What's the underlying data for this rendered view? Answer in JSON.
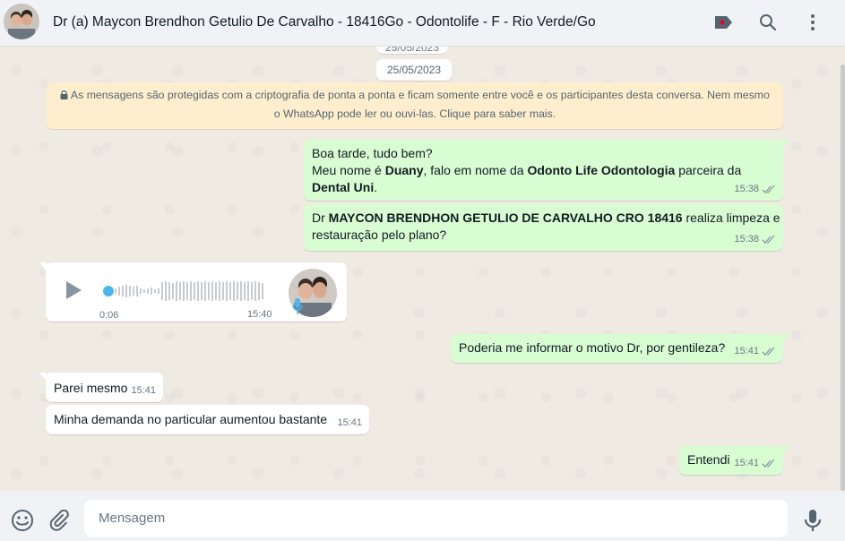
{
  "header": {
    "title": "Dr (a) Maycon Brendhon Getulio De Carvalho - 18416Go - Odontolife - F - Rio Verde/Go"
  },
  "chat": {
    "date_partial": "25/05/2023",
    "date": "25/05/2023",
    "encryption_line1": "As mensagens são protegidas com a criptografia de ponta a ponta e ficam somente entre você e os participantes desta conversa. Nem mesmo",
    "encryption_line2": "o WhatsApp pode ler ou ouvi-las. Clique para saber mais.",
    "messages": [
      {
        "line1": "Boa tarde, tudo bem?",
        "line2_pre": "Meu nome é ",
        "line2_b1": "Duany",
        "line2_mid": ", falo em nome da ",
        "line2_b2": "Odonto Life Odontologia",
        "line2_post": " parceira da",
        "line3_b": "Dental Uni",
        "line3_post": ".",
        "time": "15:38"
      },
      {
        "line1_pre": "Dr ",
        "line1_b": "MAYCON BRENDHON GETULIO DE CARVALHO CRO 18416",
        "line1_post": " realiza limpeza e",
        "line2": "restauração pelo plano?",
        "time": "15:38"
      },
      {
        "duration": "0:06",
        "time": "15:40"
      },
      {
        "text": "Poderia me informar o motivo Dr, por gentileza?",
        "time": "15:41"
      },
      {
        "text": "Parei mesmo",
        "time": "15:41"
      },
      {
        "text": "Minha demanda no particular aumentou bastante",
        "time": "15:41"
      },
      {
        "text": "Entendi",
        "time": "15:41"
      }
    ]
  },
  "footer": {
    "placeholder": "Mensagem"
  },
  "colors": {
    "outgoing": "#d9fdd3",
    "incoming": "#ffffff",
    "encryption": "#ffeecd",
    "tick": "#8696a0"
  }
}
